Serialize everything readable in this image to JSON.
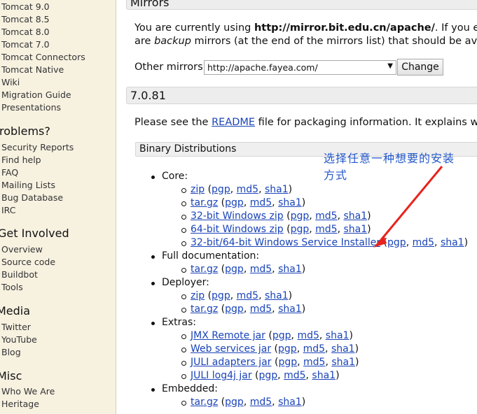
{
  "sidebar": {
    "items": [
      {
        "label": "Tomcat 9.0"
      },
      {
        "label": "Tomcat 8.5"
      },
      {
        "label": "Tomcat 8.0"
      },
      {
        "label": "Tomcat 7.0"
      },
      {
        "label": "Tomcat Connectors"
      },
      {
        "label": "Tomcat Native"
      },
      {
        "label": "Wiki"
      },
      {
        "label": "Migration Guide"
      },
      {
        "label": "Presentations"
      }
    ],
    "problems_heading": "roblems?",
    "problems_items": [
      {
        "label": "Security Reports"
      },
      {
        "label": "Find help"
      },
      {
        "label": "FAQ"
      },
      {
        "label": "Mailing Lists"
      },
      {
        "label": "Bug Database"
      },
      {
        "label": "IRC"
      }
    ],
    "involved_heading": "Get Involved",
    "involved_items": [
      {
        "label": "Overview"
      },
      {
        "label": "Source code"
      },
      {
        "label": "Buildbot"
      },
      {
        "label": "Tools"
      }
    ],
    "media_heading": "Media",
    "media_items": [
      {
        "label": "Twitter"
      },
      {
        "label": "YouTube"
      },
      {
        "label": "Blog"
      }
    ],
    "misc_heading": "Misc",
    "misc_items": [
      {
        "label": "Who We Are"
      },
      {
        "label": "Heritage"
      }
    ]
  },
  "mirrors": {
    "heading": "Mirrors",
    "line1_prefix": "You are currently using ",
    "line1_url": "http://mirror.bit.edu.cn/apache/",
    "line1_suffix": ". If you encount",
    "line2_prefix": "are ",
    "line2_em": "backup",
    "line2_suffix": " mirrors (at the end of the mirrors list) that should be available",
    "other_label": "Other mirrors:",
    "select_value": "http://apache.fayea.com/",
    "change_button": "Change"
  },
  "version": {
    "heading": "7.0.81",
    "readme_prefix": "Please see the ",
    "readme_link": "README",
    "readme_suffix": " file for packaging information. It explains what ev"
  },
  "binary": {
    "heading": "Binary Distributions",
    "core_label": "Core:",
    "full_doc_label": "Full documentation:",
    "deployer_label": "Deployer:",
    "extras_label": "Extras:",
    "embedded_label": "Embedded:",
    "sep_open": " (",
    "sep_comma": ", ",
    "sep_close": ")",
    "pgp": "pgp",
    "md5": "md5",
    "sha1": "sha1",
    "core_items": [
      "zip",
      "tar.gz",
      "32-bit Windows zip",
      "64-bit Windows zip",
      "32-bit/64-bit Windows Service Installer"
    ],
    "full_doc_items": [
      "tar.gz"
    ],
    "deployer_items": [
      "zip",
      "tar.gz"
    ],
    "extras_items": [
      "JMX Remote jar",
      "Web services jar",
      "JULI adapters jar",
      "JULI log4j jar"
    ],
    "embedded_items": [
      "tar.gz"
    ]
  },
  "annotation": {
    "line1": "选择任意一种想要的安装",
    "line2": "方式",
    "color": "#2358c9",
    "arrow_color": "#e8231d"
  }
}
